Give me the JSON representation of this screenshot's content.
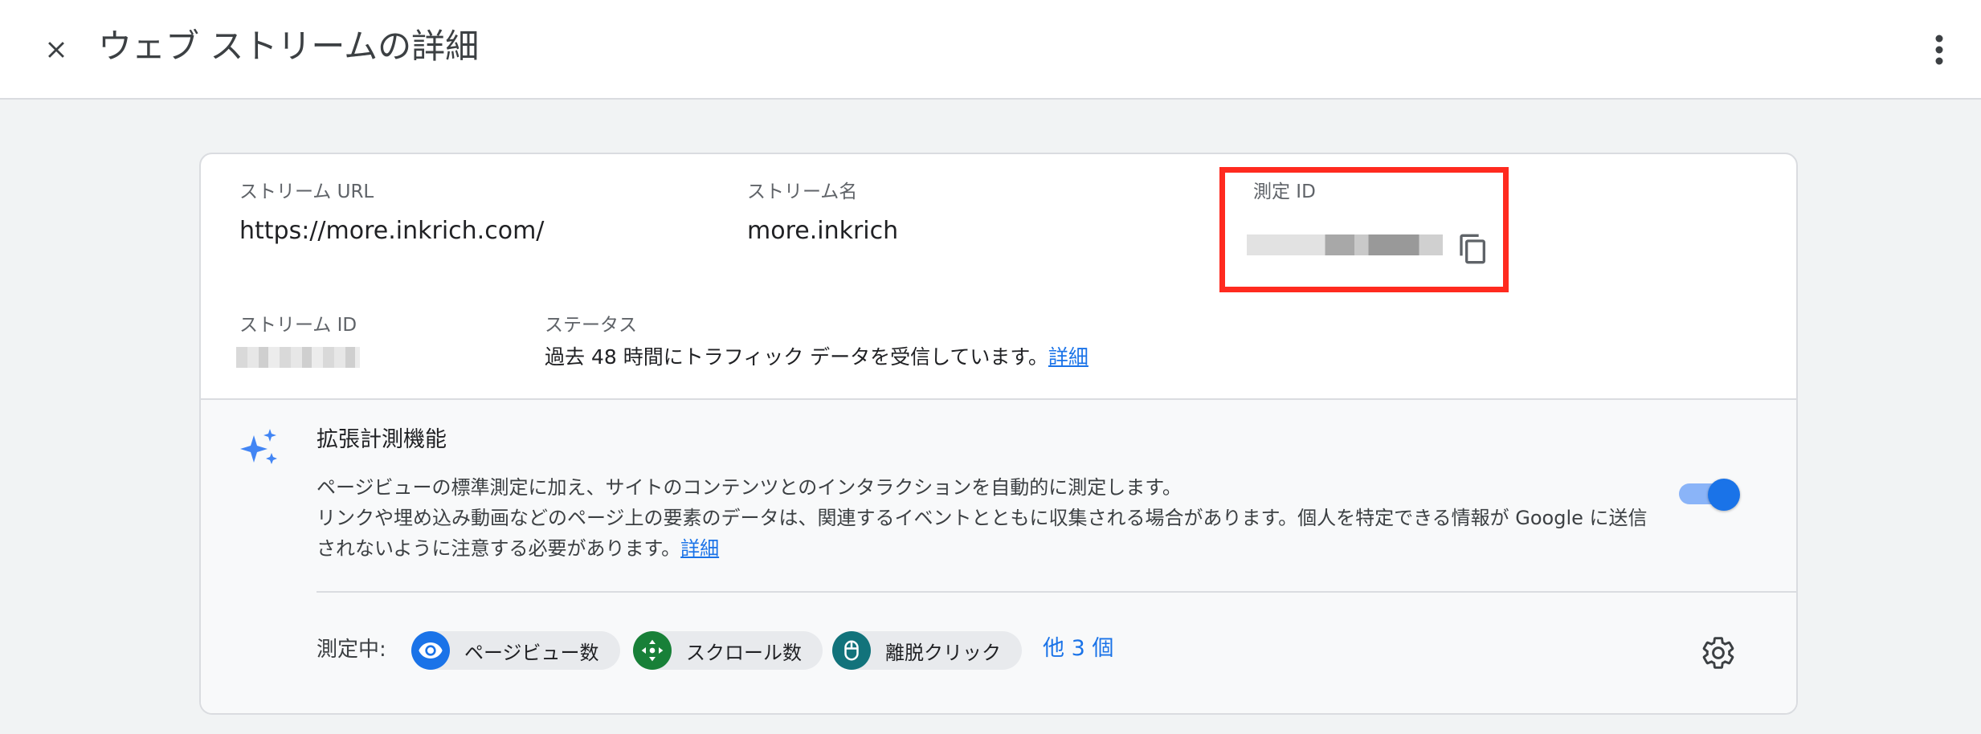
{
  "header": {
    "title": "ウェブ ストリームの詳細",
    "close_icon": "close-icon",
    "more_icon": "more-vert-icon"
  },
  "stream": {
    "url_label": "ストリーム URL",
    "url_value": "https://more.inkrich.com/",
    "name_label": "ストリーム名",
    "name_value": "more.inkrich",
    "measurement_id_label": "測定 ID",
    "copy_icon": "copy-icon",
    "stream_id_label": "ストリーム ID",
    "status_label": "ステータス",
    "status_value": "過去 48 時間にトラフィック データを受信しています。",
    "status_link": "詳細"
  },
  "enhanced_measurement": {
    "icon": "sparkle-icon",
    "title": "拡張計測機能",
    "description_line1": "ページビューの標準測定に加え、サイトのコンテンツとのインタラクションを自動的に測定します。",
    "description_line2": "リンクや埋め込み動画などのページ上の要素のデータは、関連するイベントとともに収集される場合があります。個人を特定できる情報が Google に送信",
    "description_line3": "されないように注意する必要があります。",
    "description_link": "詳細",
    "toggle_on": true,
    "measuring_label": "測定中:",
    "chips": [
      {
        "label": "ページビュー数",
        "icon": "eye-icon",
        "color": "#1a73e8"
      },
      {
        "label": "スクロール数",
        "icon": "scroll-arrows-icon",
        "color": "#188038"
      },
      {
        "label": "離脱クリック",
        "icon": "mouse-icon",
        "color": "#12737b"
      }
    ],
    "more_count": "他 3 個",
    "settings_icon": "gear-icon"
  },
  "colors": {
    "accent": "#1a73e8",
    "highlight": "#ff2a1f"
  }
}
